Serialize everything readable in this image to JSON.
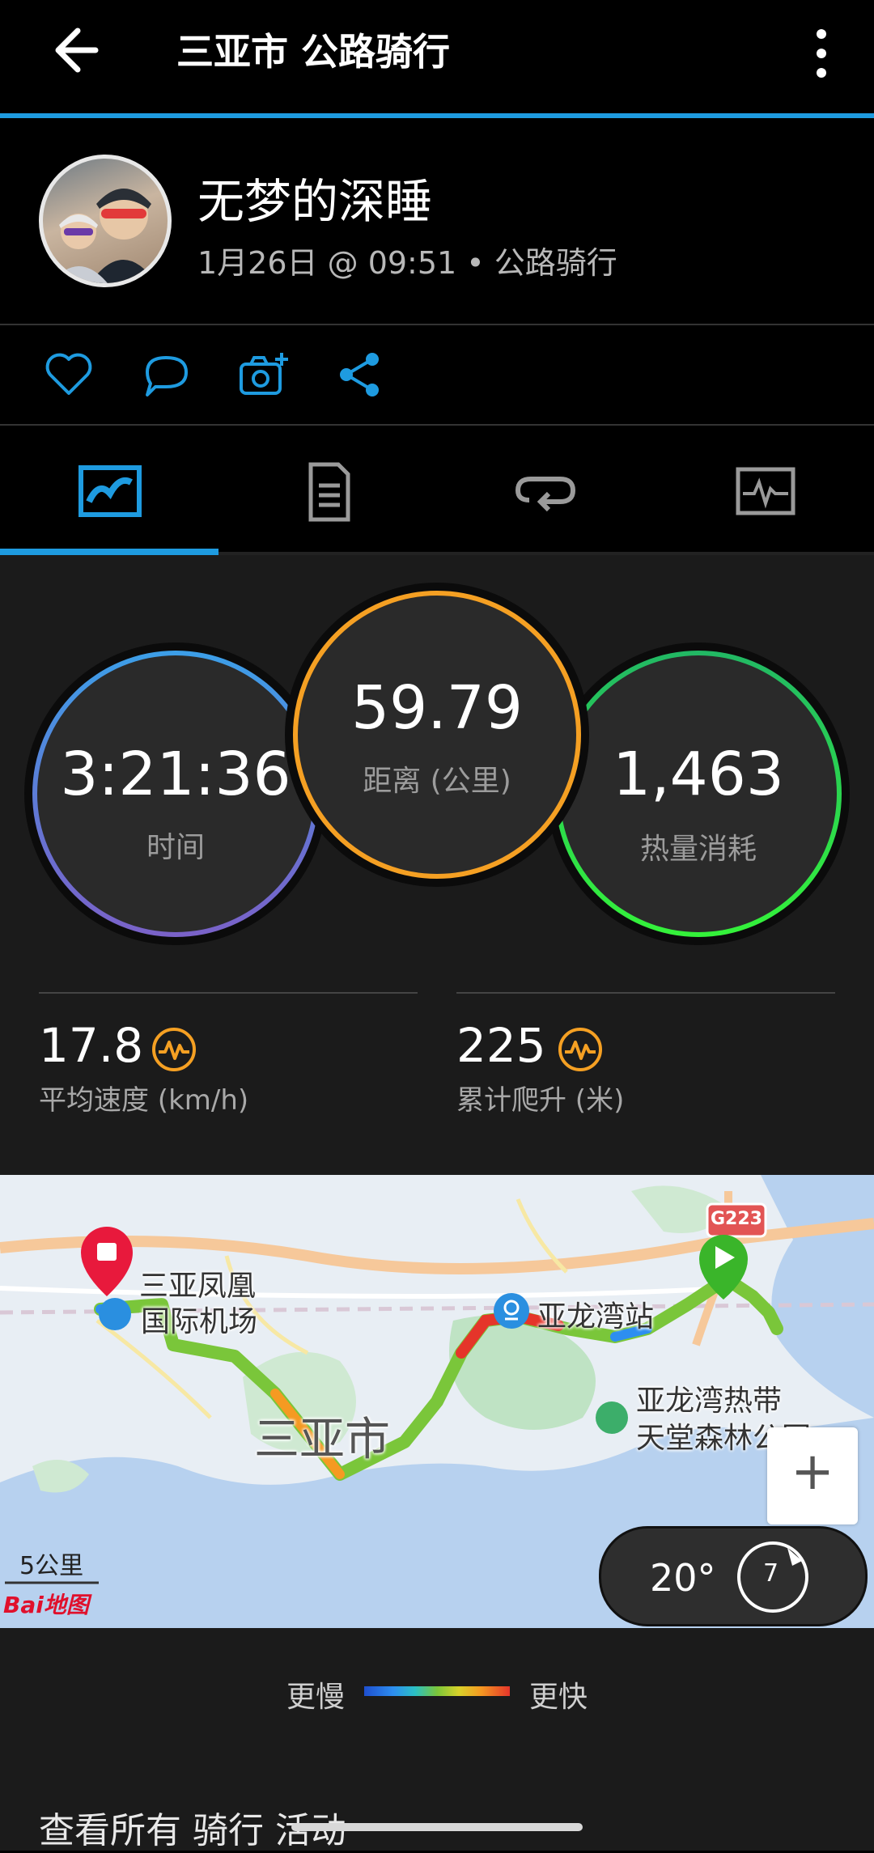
{
  "header": {
    "title": "三亚市 公路骑行",
    "back_icon": "arrow-left-icon",
    "menu_icon": "more-vert-icon"
  },
  "profile": {
    "name": "无梦的深睡",
    "subtitle": "1月26日 @ 09:51 • 公路骑行"
  },
  "actions": [
    {
      "icon": "heart-icon"
    },
    {
      "icon": "comment-icon"
    },
    {
      "icon": "camera-add-icon"
    },
    {
      "icon": "share-icon"
    }
  ],
  "tabs": [
    {
      "icon": "map-summary-icon",
      "active": true
    },
    {
      "icon": "details-list-icon",
      "active": false
    },
    {
      "icon": "laps-icon",
      "active": false
    },
    {
      "icon": "charts-icon",
      "active": false
    }
  ],
  "stats": {
    "time": {
      "value": "3:21:36",
      "label": "时间"
    },
    "distance": {
      "value": "59.79",
      "label": "距离 (公里)"
    },
    "calories": {
      "value": "1,463",
      "label": "热量消耗"
    },
    "avg_speed": {
      "value": "17.8",
      "label": "平均速度 (km/h)"
    },
    "elevation": {
      "value": "225",
      "label": "累计爬升 (米)"
    }
  },
  "map": {
    "labels": {
      "airport_1": "三亚凤凰",
      "airport_2": "国际机场",
      "station": "亚龙湾站",
      "city": "三亚市",
      "park_1": "亚龙湾热带",
      "park_2": "天堂森林公园",
      "road": "G223"
    },
    "scale": "5公里",
    "logo": "Bai地图",
    "zoom_in": "+",
    "weather": {
      "temp": "20°",
      "wind": "7"
    }
  },
  "legend": {
    "slow": "更慢",
    "fast": "更快"
  },
  "bottom": {
    "link": "查看所有 骑行 活动"
  },
  "colors": {
    "accent": "#1e9be0",
    "time": "#3b9be8",
    "distance": "#f5a023",
    "calories": "#2ee04a"
  }
}
